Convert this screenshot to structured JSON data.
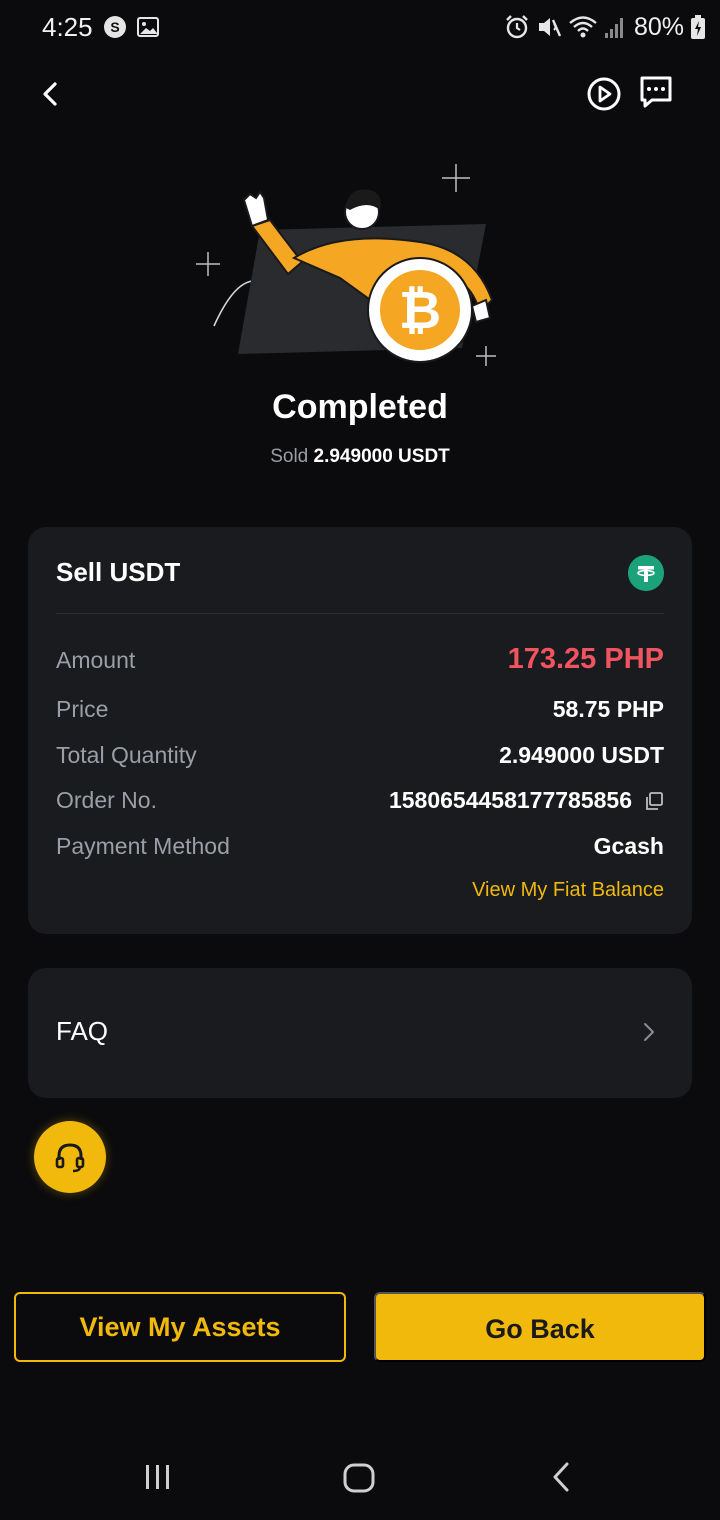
{
  "status_bar": {
    "time": "4:25",
    "battery": "80%",
    "left_icons": [
      "s-app-icon",
      "gallery-icon"
    ],
    "right_icons": [
      "alarm-icon",
      "mute-icon",
      "wifi-icon",
      "signal-icon",
      "battery-icon"
    ]
  },
  "header": {
    "icons": [
      "back-arrow-icon",
      "play-circle-icon",
      "chat-icon"
    ]
  },
  "hero": {
    "title": "Completed",
    "sold_prefix": "Sold",
    "sold_amount": "2.949000 USDT"
  },
  "order": {
    "title": "Sell USDT",
    "rows": [
      {
        "label": "Amount",
        "value": "173.25 PHP"
      },
      {
        "label": "Price",
        "value": "58.75 PHP"
      },
      {
        "label": "Total Quantity",
        "value": "2.949000 USDT"
      },
      {
        "label": "Order No.",
        "value": "1580654458177785856"
      },
      {
        "label": "Payment Method",
        "value": "Gcash"
      }
    ],
    "fiat_link": "View My Fiat Balance"
  },
  "faq": {
    "label": "FAQ"
  },
  "buttons": {
    "view_assets": "View My Assets",
    "go_back": "Go Back"
  },
  "colors": {
    "accent": "#f0b90b",
    "amount_red": "#f0545f",
    "tether_green": "#1ba27a",
    "card_bg": "#1a1b1f",
    "page_bg": "#0b0b0d"
  }
}
